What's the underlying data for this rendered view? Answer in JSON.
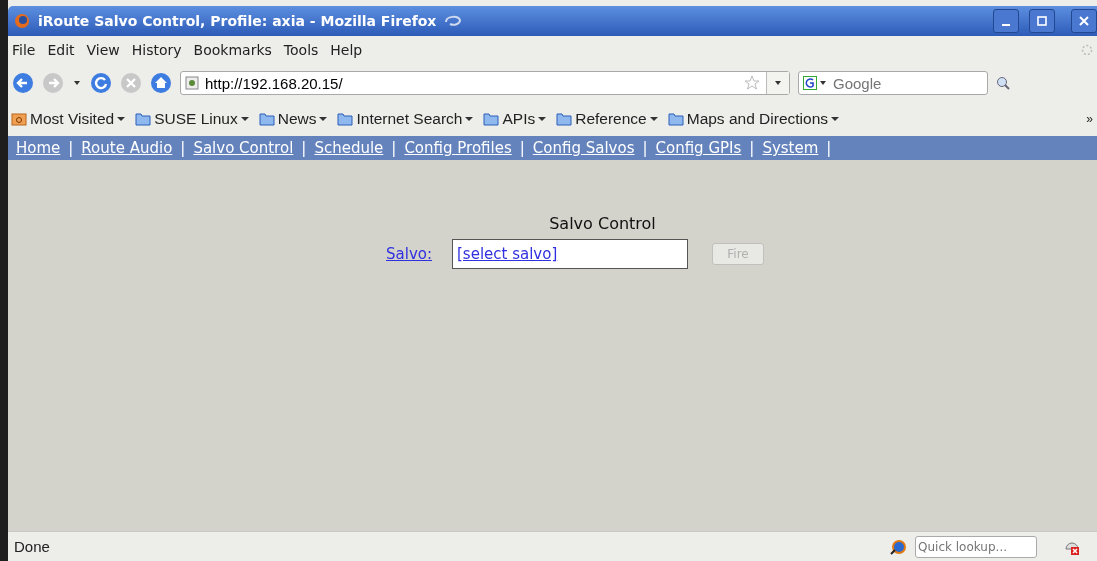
{
  "window": {
    "title": "iRoute Salvo Control, Profile: axia - Mozilla Firefox"
  },
  "menu": [
    "File",
    "Edit",
    "View",
    "History",
    "Bookmarks",
    "Tools",
    "Help"
  ],
  "navigation": {
    "back_disabled": false,
    "forward_disabled": true,
    "url": "http://192.168.20.15/",
    "search_placeholder": "Google"
  },
  "bookmarks": [
    {
      "label": "Most Visited",
      "kind": "smart"
    },
    {
      "label": "SUSE Linux",
      "kind": "folder"
    },
    {
      "label": "News",
      "kind": "folder"
    },
    {
      "label": "Internet Search",
      "kind": "folder"
    },
    {
      "label": "APIs",
      "kind": "folder"
    },
    {
      "label": "Reference",
      "kind": "folder"
    },
    {
      "label": "Maps and Directions",
      "kind": "folder"
    }
  ],
  "bookmarks_overflow": "»",
  "site_nav": [
    "Home",
    "Route Audio",
    "Salvo Control",
    "Schedule",
    "Config Profiles",
    "Config Salvos",
    "Config GPIs",
    "System"
  ],
  "site_nav_separator": "|",
  "page": {
    "heading": "Salvo Control",
    "salvo_label": "Salvo:",
    "salvo_value": "[select salvo]",
    "fire_button": {
      "label": "Fire",
      "disabled": true
    }
  },
  "status_bar": {
    "text": "Done",
    "lookup_placeholder": "Quick lookup..."
  }
}
